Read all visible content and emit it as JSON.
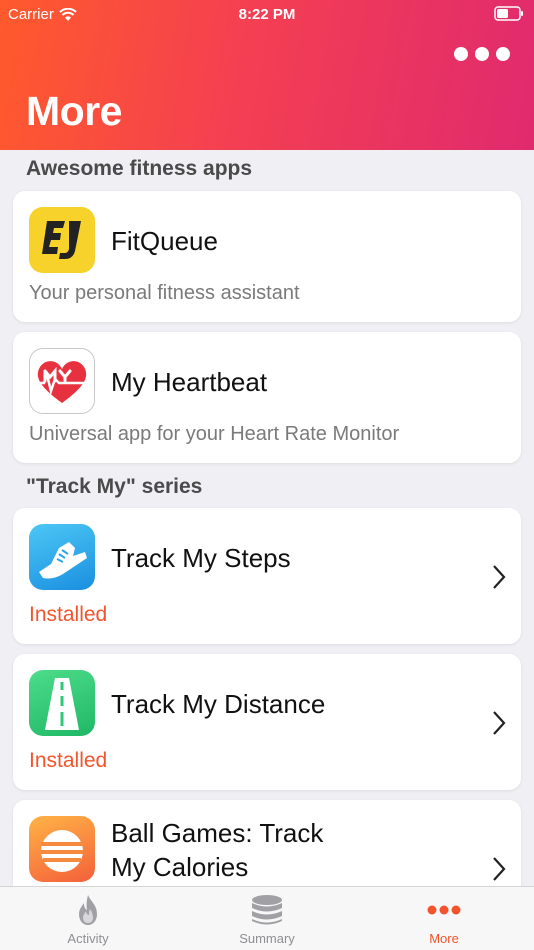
{
  "status_bar": {
    "carrier": "Carrier",
    "time": "8:22 PM"
  },
  "header": {
    "title": "More"
  },
  "sections": [
    {
      "title": "Awesome fitness apps"
    },
    {
      "title": "\"Track My\" series"
    }
  ],
  "apps": {
    "fitqueue": {
      "name": "FitQueue",
      "subtitle": "Your personal fitness assistant"
    },
    "heartbeat": {
      "name": "My Heartbeat",
      "subtitle": "Universal app for your Heart Rate Monitor"
    },
    "steps": {
      "name": "Track My Steps",
      "status": "Installed"
    },
    "distance": {
      "name": "Track My Distance",
      "status": "Installed"
    },
    "calories": {
      "name_line1": "Ball Games: Track",
      "name_line2": "My Calories"
    }
  },
  "tabbar": {
    "tabs": [
      {
        "label": "Activity",
        "icon": "flame-icon"
      },
      {
        "label": "Summary",
        "icon": "database-icon"
      },
      {
        "label": "More",
        "icon": "dots-icon"
      }
    ],
    "active": "More"
  },
  "colors": {
    "accent": "#f2542d",
    "header_start": "#ff5a2c",
    "header_end": "#e02a6e"
  }
}
